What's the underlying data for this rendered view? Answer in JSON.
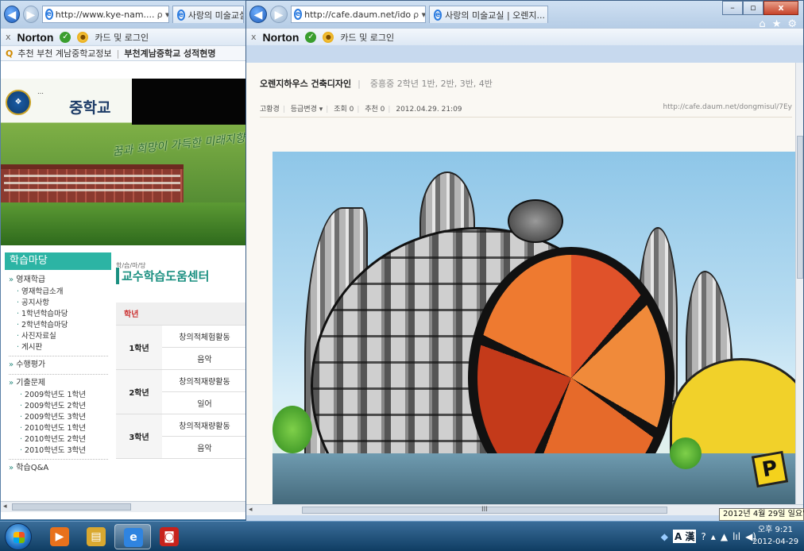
{
  "back_window": {
    "address": "http://www.kye-nam....",
    "address_controls": "ρ ▾ ¢ X",
    "tab_label": "사랑의 미술교실",
    "toolbar": {
      "close": "x",
      "norton": "Norton",
      "card_login": "카드 및 로그인"
    },
    "favorites": {
      "item1": "추천 부천 계남중학교정보",
      "item2": "부천계남중학교 성적현명"
    },
    "school": {
      "slogan": "…",
      "name": "중학교",
      "calligraphy": "꿈과 희망이 가득한 미래지향 계남중학"
    },
    "sidebar": {
      "header": "학습마당",
      "items": [
        {
          "kind": "cat",
          "label": "영재학급"
        },
        {
          "kind": "item",
          "label": "영재학급소개"
        },
        {
          "kind": "item",
          "label": "공지사항"
        },
        {
          "kind": "item",
          "label": "1학년학습마당"
        },
        {
          "kind": "item",
          "label": "2학년학습마당"
        },
        {
          "kind": "item",
          "label": "사진자료실"
        },
        {
          "kind": "item",
          "label": "게시판"
        },
        {
          "kind": "cat",
          "label": "수행평가"
        },
        {
          "kind": "cat",
          "label": "기출문제"
        },
        {
          "kind": "sub",
          "label": "2009학년도 1학년"
        },
        {
          "kind": "sub",
          "label": "2009학년도 2학년"
        },
        {
          "kind": "sub",
          "label": "2009학년도 3학년"
        },
        {
          "kind": "sub",
          "label": "2010학년도 1학년"
        },
        {
          "kind": "sub",
          "label": "2010학년도 2학년"
        },
        {
          "kind": "sub",
          "label": "2010학년도 3학년"
        },
        {
          "kind": "cat",
          "label": "학습Q&A"
        }
      ]
    },
    "center": {
      "breadcrumb": "학/습/마/당",
      "title": "교수학습도움센터",
      "table_header": "학년",
      "rows": [
        {
          "grade": "1학년",
          "a": "창의적체험활동",
          "b": "음악"
        },
        {
          "grade": "2학년",
          "a": "창의적재량활동",
          "b": "일어"
        },
        {
          "grade": "3학년",
          "a": "창의적재량활동",
          "b": "음악"
        }
      ]
    }
  },
  "front_window": {
    "address": "http://cafe.daum.net/ido",
    "address_controls": "ρ ▾ ¢ X",
    "tab_label": "사랑의 미술교실 | 오렌지...",
    "tab_close": "×",
    "window_controls": {
      "minimize": "–",
      "restore": "▫",
      "close": "x"
    },
    "top_icons": {
      "home": "⌂",
      "star": "★",
      "gear": "⚙"
    },
    "toolbar": {
      "close": "x",
      "norton": "Norton",
      "card_login": "카드 및 로그인"
    },
    "post": {
      "title": "오렌지하우스 건축디자인",
      "subtitle": "중흥중 2학년 1반, 2반, 3반, 4반",
      "author": "고황경",
      "grade_change": "등급변경 ▾",
      "views": "조회 0",
      "likes": "추천 0",
      "date": "2012.04.29. 21:09",
      "url": "http://cafe.daum.net/dongmisul/7Ey"
    },
    "scroll_label": "III"
  },
  "date_tooltip": "2012년 4월 29일 일요일",
  "taskbar": {
    "apps": [
      {
        "icon": "media-player-icon",
        "glyph": "▶",
        "color": "#e8711c"
      },
      {
        "icon": "file-explorer-icon",
        "glyph": "▤",
        "color": "#d9a830"
      },
      {
        "icon": "internet-explorer-icon",
        "glyph": "e",
        "color": "#2f84e0"
      },
      {
        "icon": "pdf-app-icon",
        "glyph": "◙",
        "color": "#c8221c"
      }
    ],
    "tray": {
      "ime": "A 漢",
      "help": "?",
      "up": "▴",
      "net": "▲",
      "signal": "lıl",
      "volume": "◀)"
    },
    "clock_time": "오후 9:21",
    "clock_date": "2012-04-29"
  }
}
